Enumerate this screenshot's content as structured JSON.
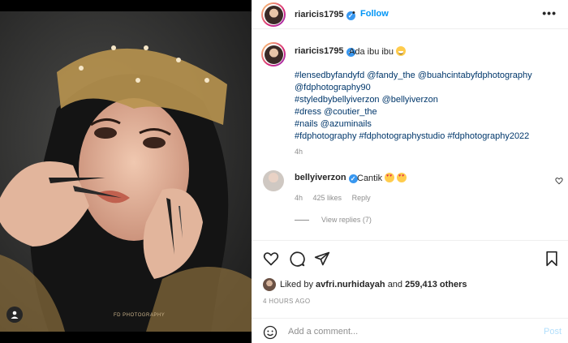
{
  "post": {
    "username": "riaricis1795",
    "follow_label": "Follow",
    "dot": "•",
    "more": "•••",
    "caption_text": "Ada ibu ibu",
    "caption_lines": [
      "#lensedbyfandyfd @fandy_the @buahcintabyfdphotography",
      "@fdphotography90",
      "#styledbybellyiverzon @bellyiverzon",
      "#dress @coutier_the",
      "#nails @azuminails",
      "#fdphotography #fdphotographystudio #fdphotography2022"
    ],
    "caption_time": "4h",
    "watermark": "FD PHOTOGRAPHY"
  },
  "comment": {
    "username": "bellyiverzon",
    "text": "Cantik",
    "time": "4h",
    "likes": "425 likes",
    "reply": "Reply",
    "view_replies": "View replies (7)"
  },
  "likes": {
    "prefix": "Liked by",
    "user": "avfri.nurhidayah",
    "and": "and",
    "count": "259,413 others"
  },
  "posted": "4 HOURS AGO",
  "add_comment": {
    "placeholder": "Add a comment...",
    "post_label": "Post"
  },
  "colors": {
    "accent": "#0095f6",
    "verified": "#3897f0",
    "post_disabled": "#b2dffc"
  }
}
